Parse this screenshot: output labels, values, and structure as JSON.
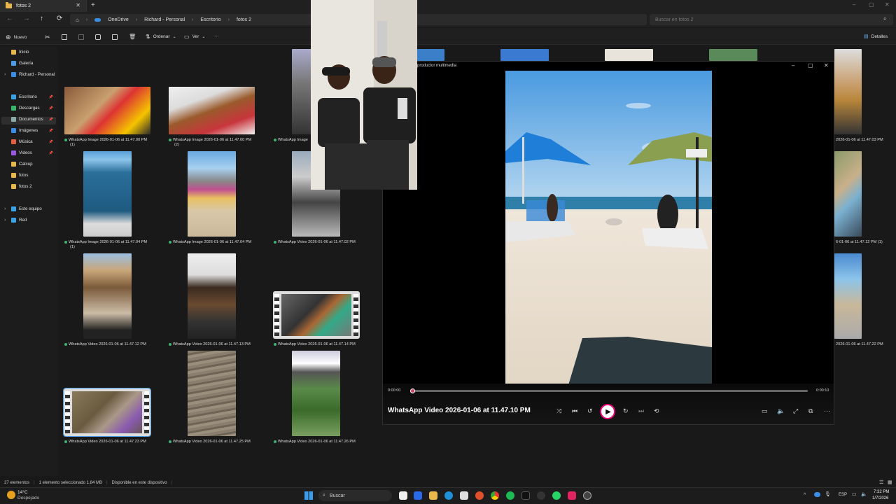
{
  "tab": {
    "title": "fotos 2",
    "close": "✕",
    "add": "+"
  },
  "window_controls": [
    "–",
    "▢",
    "✕"
  ],
  "nav": {
    "back": "←",
    "forward": "→",
    "up": "↑",
    "refresh": "⟳"
  },
  "breadcrumb": [
    "OneDrive",
    "Richard - Personal",
    "Escritorio",
    "fotos 2"
  ],
  "search": {
    "placeholder": "Buscar en fotos 2"
  },
  "toolbar": {
    "new_label": "Nuevo",
    "sort_label": "Ordenar",
    "view_label": "Ver",
    "more": "···",
    "details_label": "Detalles"
  },
  "sidebar": {
    "items": [
      {
        "label": "Inicio",
        "icon": "home-icon",
        "color": "#e8b84a"
      },
      {
        "label": "Galería",
        "icon": "gallery-icon",
        "color": "#4a9be8"
      },
      {
        "label": "Richard - Personal",
        "icon": "onedrive-icon",
        "color": "#3a8ee6"
      },
      {
        "label": "Escritorio",
        "icon": "desktop-icon",
        "color": "#3aa4e6"
      },
      {
        "label": "Descargas",
        "icon": "downloads-icon",
        "color": "#39b56a"
      },
      {
        "label": "Documentos",
        "icon": "documents-icon",
        "color": "#8aa"
      },
      {
        "label": "Imágenes",
        "icon": "pictures-icon",
        "color": "#3a8ee6"
      },
      {
        "label": "Música",
        "icon": "music-icon",
        "color": "#e06040"
      },
      {
        "label": "Videos",
        "icon": "videos-icon",
        "color": "#9a5ae0"
      },
      {
        "label": "Catcup",
        "icon": "folder-icon",
        "color": "#e8b84a"
      },
      {
        "label": "fotos",
        "icon": "folder-icon",
        "color": "#e8b84a"
      },
      {
        "label": "fotos 2",
        "icon": "folder-icon",
        "color": "#e8b84a"
      },
      {
        "label": "Este equipo",
        "icon": "pc-icon",
        "color": "#3aa4e6"
      },
      {
        "label": "Red",
        "icon": "network-icon",
        "color": "#3aa4e6"
      }
    ]
  },
  "files": [
    {
      "name": "WhatsApp Image 2026-01-06 at 11.47.00 PM",
      "sub": "(1)"
    },
    {
      "name": "WhatsApp Image 2026-01-06 at 11.47.00 PM",
      "sub": "(2)"
    },
    {
      "name": "WhatsApp Image",
      "sub": ""
    },
    {
      "name": "WhatsApp Image 2026-01-06 at 11.47.04 PM",
      "sub": "(1)"
    },
    {
      "name": "WhatsApp Image 2026-01-06 at 11.47.04 PM",
      "sub": ""
    },
    {
      "name": "WhatsApp Video 2026-01-06 at 11.47.02 PM",
      "sub": ""
    },
    {
      "name": "WhatsApp Video 2026-01-06 at 11.47.12 PM",
      "sub": ""
    },
    {
      "name": "WhatsApp Video 2026-01-06 at 11.47.13 PM",
      "sub": ""
    },
    {
      "name": "WhatsApp Video 2026-01-06 at 11.47.14 PM",
      "sub": ""
    },
    {
      "name": "WhatsApp Video 2026-01-06 at 11.47.23 PM",
      "sub": ""
    },
    {
      "name": "WhatsApp Video 2026-01-06 at 11.47.25 PM",
      "sub": ""
    },
    {
      "name": "WhatsApp Video 2026-01-06 at 11.47.26 PM",
      "sub": ""
    },
    {
      "name": "2026-01-06 at 11.47.03 PM",
      "sub": ""
    },
    {
      "name": "6-01-06 at 11.47.12 PM (1)",
      "sub": ""
    },
    {
      "name": "2026-01-06 at 11.47.22 PM",
      "sub": ""
    }
  ],
  "player": {
    "title": "productor multimedia",
    "video_title": "WhatsApp Video 2026-01-06 at 11.47.10 PM",
    "time_current": "0:00:00",
    "time_total": "0:00:10",
    "progress": 0.0,
    "controls": {
      "minimize": "–",
      "maximize": "▢",
      "close": "✕"
    }
  },
  "status": {
    "count": "27 elementos",
    "selected": "1 elemento seleccionado  1.84 MB",
    "availability": "Disponible en este dispositivo"
  },
  "taskbar": {
    "weather_temp": "14°C",
    "weather_desc": "Despejado",
    "search_label": "Buscar",
    "lang": "ESP",
    "time": "7:32 PM",
    "date": "1/7/2026"
  }
}
